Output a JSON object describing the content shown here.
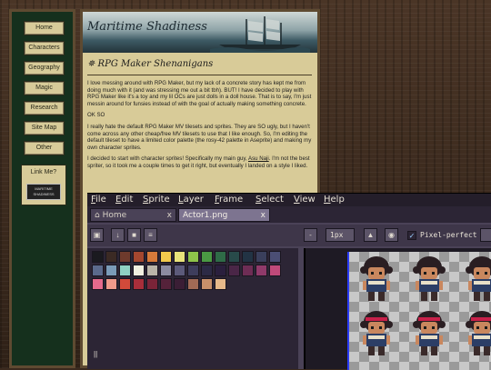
{
  "sidebar": {
    "items": [
      "Home",
      "Characters",
      "Geography",
      "Magic",
      "Research",
      "Site Map",
      "Other"
    ],
    "linkme_label": "Link Me?",
    "linkme_banner": "MARITIME SHADINESS"
  },
  "blog": {
    "site_title": "Maritime Shadiness",
    "post_title": "✵ RPG Maker Shenanigans",
    "paragraphs": [
      "I love messing around with RPG Maker, but my lack of a concrete story has kept me from doing much with it (and was stressing me out a bit tbh). BUT! I have decided to play with RPG Maker like it's a toy and my lil OCs are just dolls in a doll house. That is to say, I'm just messin around for funsies instead of with the goal of actually making something concrete.",
      "OK SO",
      "I really hate the default RPG Maker MV tilesets and sprites. They are SO ugly, but I haven't come across any other cheap/free MV tilesets to use that I like enough. So, I'm editing the default tileset to have a limited color palette (the rosy-42 palette in Aseprite) and making my own character sprites."
    ],
    "p4_before": "I decided to start with character sprites! Specifically my main guy, ",
    "p4_link": "Asu Naji",
    "p4_after": ". I'm not the best spriter, so it took me a couple times to get it right, but eventually I landed on a style I liked."
  },
  "aseprite": {
    "menu": [
      "File",
      "Edit",
      "Sprite",
      "Layer",
      "Frame",
      "Select",
      "View",
      "Help"
    ],
    "tabs": [
      {
        "label": "Home",
        "active": false,
        "close": "x"
      },
      {
        "label": "Actor1.png",
        "active": true,
        "close": "x"
      }
    ],
    "toolbar": {
      "minus_label": "-",
      "brush_size": "1px",
      "pixel_perfect_checked": "✓",
      "pixel_perfect_label": "Pixel-perfect"
    },
    "palette": [
      "#1a1a1f",
      "#3b2a24",
      "#6e3a2c",
      "#a4472f",
      "#d77a3a",
      "#f2c94c",
      "#e8e27a",
      "#8ec34a",
      "#4a9a43",
      "#2f6b47",
      "#284a4a",
      "#223344",
      "#3a3f5c",
      "#4b4e74",
      "#5b6a8c",
      "#7a9bb8",
      "#8fd1c2",
      "#f1f0e0",
      "#b9b4a8",
      "#8c8ba0",
      "#5c5a7a",
      "#3e3d5c",
      "#2c2a45",
      "#2a1f3d",
      "#4a2647",
      "#6e2d55",
      "#8f3a6a",
      "#c04a7a",
      "#e56a8c",
      "#f09a8a",
      "#d24a3a",
      "#a82e3a",
      "#7a2438",
      "#55223a",
      "#3a1e35",
      "#a06a55",
      "#c8906a",
      "#e6b98a"
    ],
    "palette_cursor": "||"
  }
}
